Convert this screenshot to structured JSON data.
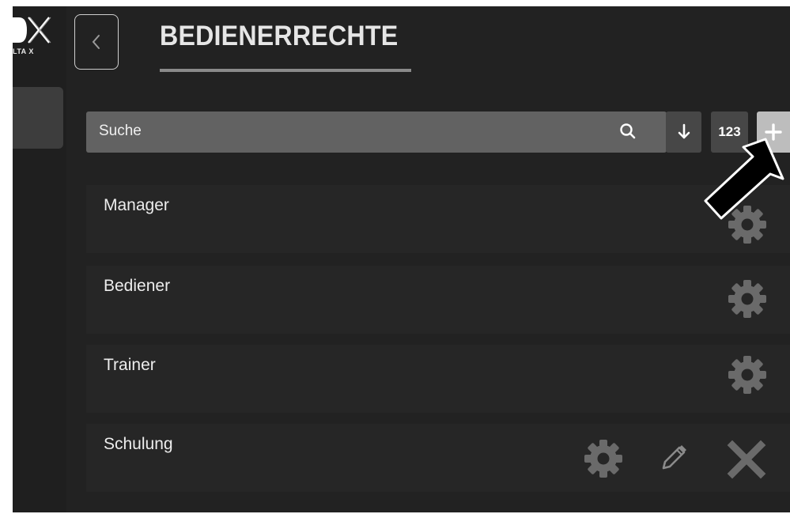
{
  "app": {
    "logo_main": "DX",
    "logo_sub": "LTA X"
  },
  "header": {
    "title": "BEDIENERRECHTE"
  },
  "toolbar": {
    "search_placeholder": "Suche",
    "numeric_label": "123"
  },
  "list": {
    "items": [
      {
        "label": "Manager"
      },
      {
        "label": "Bediener"
      },
      {
        "label": "Trainer"
      },
      {
        "label": "Schulung"
      }
    ]
  },
  "colors": {
    "background": "#222222",
    "search_bg": "#626262",
    "button_bg": "#474747",
    "add_button_bg": "#bdbdbd",
    "icon_gray": "#6a6a6a"
  }
}
